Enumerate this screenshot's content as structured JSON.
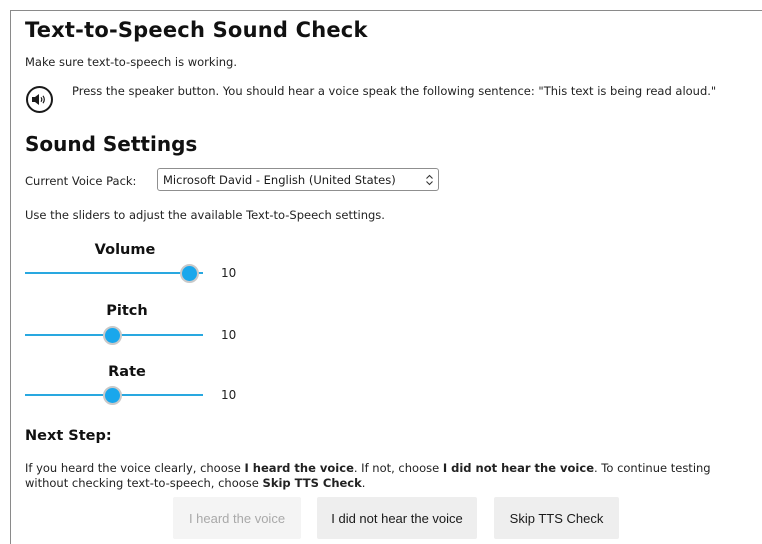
{
  "page": {
    "title": "Text-to-Speech Sound Check",
    "intro": "Make sure text-to-speech is working.",
    "speaker_icon": "speaker-volume-icon",
    "instruction": "Press the speaker button. You should hear a voice speak the following sentence: \"This text is being read aloud.\""
  },
  "settings": {
    "title": "Sound Settings",
    "voice_label": "Current Voice Pack:",
    "voice_selected": "Microsoft David - English (United States)",
    "sliders_hint": "Use the sliders to adjust the available Text-to-Speech settings.",
    "sliders": [
      {
        "label": "Volume",
        "value": "10",
        "level": 1.0
      },
      {
        "label": "Pitch",
        "value": "10",
        "level": 0.5
      },
      {
        "label": "Rate",
        "value": "10",
        "level": 0.5
      }
    ]
  },
  "next": {
    "title": "Next Step:",
    "text_1": "If you heard the voice clearly, choose ",
    "bold_1": "I heard the voice",
    "text_2": ". If not, choose ",
    "bold_2": "I did not hear the voice",
    "text_3": ". To continue testing without checking text-to-speech, choose ",
    "bold_3": "Skip TTS Check",
    "text_4": "."
  },
  "buttons": {
    "heard": "I heard the voice",
    "not_heard": "I did not hear the voice",
    "skip": "Skip TTS Check"
  },
  "colors": {
    "slider_accent": "#19a7ec",
    "track": "#29a8e0"
  }
}
